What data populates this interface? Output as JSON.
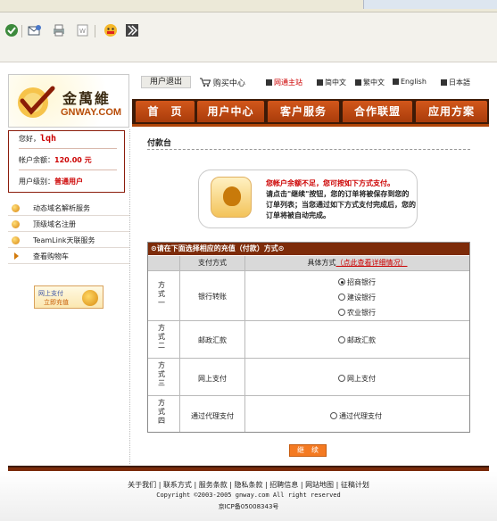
{
  "brand": {
    "name_cn": "金萬維",
    "name_en": "GNWAY.COM",
    "colors": {
      "accent": "#a93c0b",
      "nav_dark": "#3d1a07",
      "alert_red": "#cc0000"
    }
  },
  "topbar": {
    "logout": "用户退出",
    "cart": "购买中心",
    "languages": [
      "网通主站",
      "简中文",
      "繁中文",
      "English",
      "日本語"
    ]
  },
  "nav": {
    "items": [
      "首　页",
      "用户中心",
      "客户服务",
      "合作联盟",
      "应用方案"
    ]
  },
  "user_panel": {
    "greeting_label": "您好，",
    "username": "lqh",
    "balance_label": "帐户余额：",
    "balance_value": "120.00 元",
    "level_label": "用户级别：",
    "level_value": "普通用户"
  },
  "sidebar": {
    "items": [
      "动态域名解析服务",
      "顶级域名注册",
      "TeamLink天联服务",
      "查看购物车"
    ]
  },
  "pay_banner": {
    "line1": "网上支付",
    "line2": "立即充值"
  },
  "page": {
    "title": "付款台",
    "notice_line1": "您帐户余额不足，您可按如下方式支付。",
    "notice_line2": "请点击\"继续\"按钮，您的订单将被保存到您的订单列表；当您通过如下方式支付完成后，您的订单将被自动完成。"
  },
  "payment_table": {
    "header": "⊙请在下面选择相应的充值（付款）方式⊙",
    "col_method": "支付方式",
    "col_detail": "具体方式",
    "col_detail_link": "（点此查看详细情况）",
    "rows": [
      {
        "way": "方式一",
        "method": "银行转账",
        "options": [
          "招商银行",
          "建设银行",
          "农业银行"
        ],
        "selected": 0
      },
      {
        "way": "方式二",
        "method": "邮政汇款",
        "options": [
          "邮政汇款"
        ],
        "selected": -1
      },
      {
        "way": "方式三",
        "method": "网上支付",
        "options": [
          "网上支付"
        ],
        "selected": -1
      },
      {
        "way": "方式四",
        "method": "通过代理支付",
        "options": [
          "通过代理支付"
        ],
        "selected": -1
      }
    ]
  },
  "continue_button": "继　续",
  "footer": {
    "links": [
      "关于我们",
      "联系方式",
      "服务条款",
      "隐私条款",
      "招聘信息",
      "网站地图",
      "征稿计划"
    ],
    "copyright": "Copyright ©2003-2005 gnway.com All right reserved",
    "icp": "京ICP备05008343号"
  }
}
